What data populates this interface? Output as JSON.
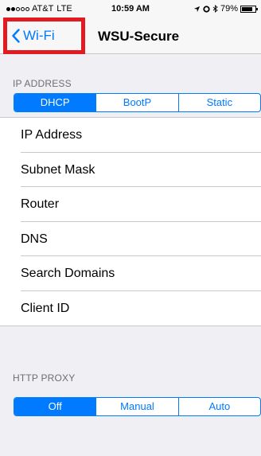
{
  "status_bar": {
    "carrier": "AT&T",
    "network": "LTE",
    "time": "10:59 AM",
    "battery": "79%",
    "battery_level": 0.79,
    "signal_bars_filled": 2,
    "signal_bars_total": 5
  },
  "nav": {
    "back_label": "Wi-Fi",
    "title": "WSU-Secure",
    "highlight_color": "#e21b22"
  },
  "sections": {
    "ip_address_header": "IP ADDRESS",
    "ip_modes": [
      "DHCP",
      "BootP",
      "Static"
    ],
    "ip_mode_selected": "DHCP",
    "rows": [
      "IP Address",
      "Subnet Mask",
      "Router",
      "DNS",
      "Search Domains",
      "Client ID"
    ],
    "http_proxy_header": "HTTP PROXY",
    "proxy_modes": [
      "Off",
      "Manual",
      "Auto"
    ],
    "proxy_mode_selected": "Off"
  },
  "colors": {
    "accent": "#007aff",
    "background": "#efeff4",
    "separator": "#c8c7cc"
  }
}
